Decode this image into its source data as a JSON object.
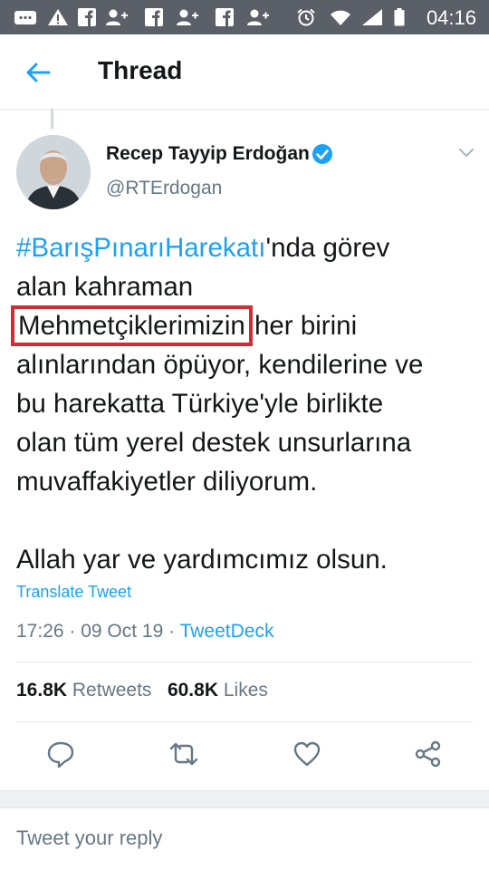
{
  "status_bar": {
    "icons": [
      "message-icon",
      "alert-icon",
      "facebook-icon",
      "add-user-icon",
      "facebook-icon",
      "add-user-icon",
      "facebook-icon",
      "add-user-icon",
      "alarm-icon",
      "wifi-icon",
      "signal-icon",
      "battery-icon"
    ],
    "time": "04:16"
  },
  "header": {
    "title": "Thread"
  },
  "tweet": {
    "author_name": "Recep Tayyip Erdoğan",
    "handle": "@RTErdogan",
    "hashtag": "#BarışPınarıHarekatı",
    "text_part1": "'nda görev\nalan kahraman\n",
    "highlighted": "Mehmetçiklerimizin",
    "text_part2": " her birini\nalınlarından öpüyor, kendilerine ve\nbu harekatta Türkiye'yle birlikte\nolan tüm yerel destek unsurlarına\nmuvaffakiyetler diliyorum.\n\nAllah yar ve yardımcımız olsun.",
    "translate_label": "Translate Tweet",
    "time": "17:26",
    "date": "09 Oct 19",
    "source": "TweetDeck",
    "retweets_count": "16.8K",
    "retweets_label": "Retweets",
    "likes_count": "60.8K",
    "likes_label": "Likes"
  },
  "reply": {
    "placeholder": "Tweet your reply"
  },
  "colors": {
    "accent": "#1da1f2",
    "highlight_box": "#d32a33",
    "muted": "#657786"
  }
}
